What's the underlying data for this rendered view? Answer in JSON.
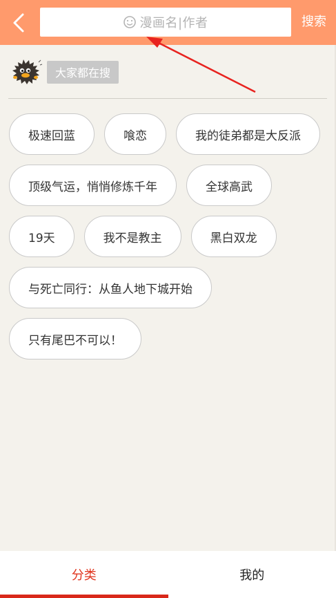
{
  "header": {
    "search_placeholder": "漫画名|作者",
    "search_button": "搜索",
    "bg_color": "#ff9a6c"
  },
  "hot": {
    "label": "大家都在搜",
    "tags": [
      "极速回蓝",
      "喰恋",
      "我的徒弟都是大反派",
      "顶级气运，悄悄修炼千年",
      "全球高武",
      "19天",
      "我不是教主",
      "黑白双龙",
      "与死亡同行：从鱼人地下城开始",
      "只有尾巴不可以！"
    ]
  },
  "tabbar": {
    "tabs": [
      {
        "label": "分类",
        "active": true
      },
      {
        "label": "我的",
        "active": false
      }
    ],
    "active_color": "#e0341e"
  },
  "icons": {
    "back": "chevron-left-icon",
    "search": "smiley-search-icon",
    "mascot": "mascot-icon"
  }
}
